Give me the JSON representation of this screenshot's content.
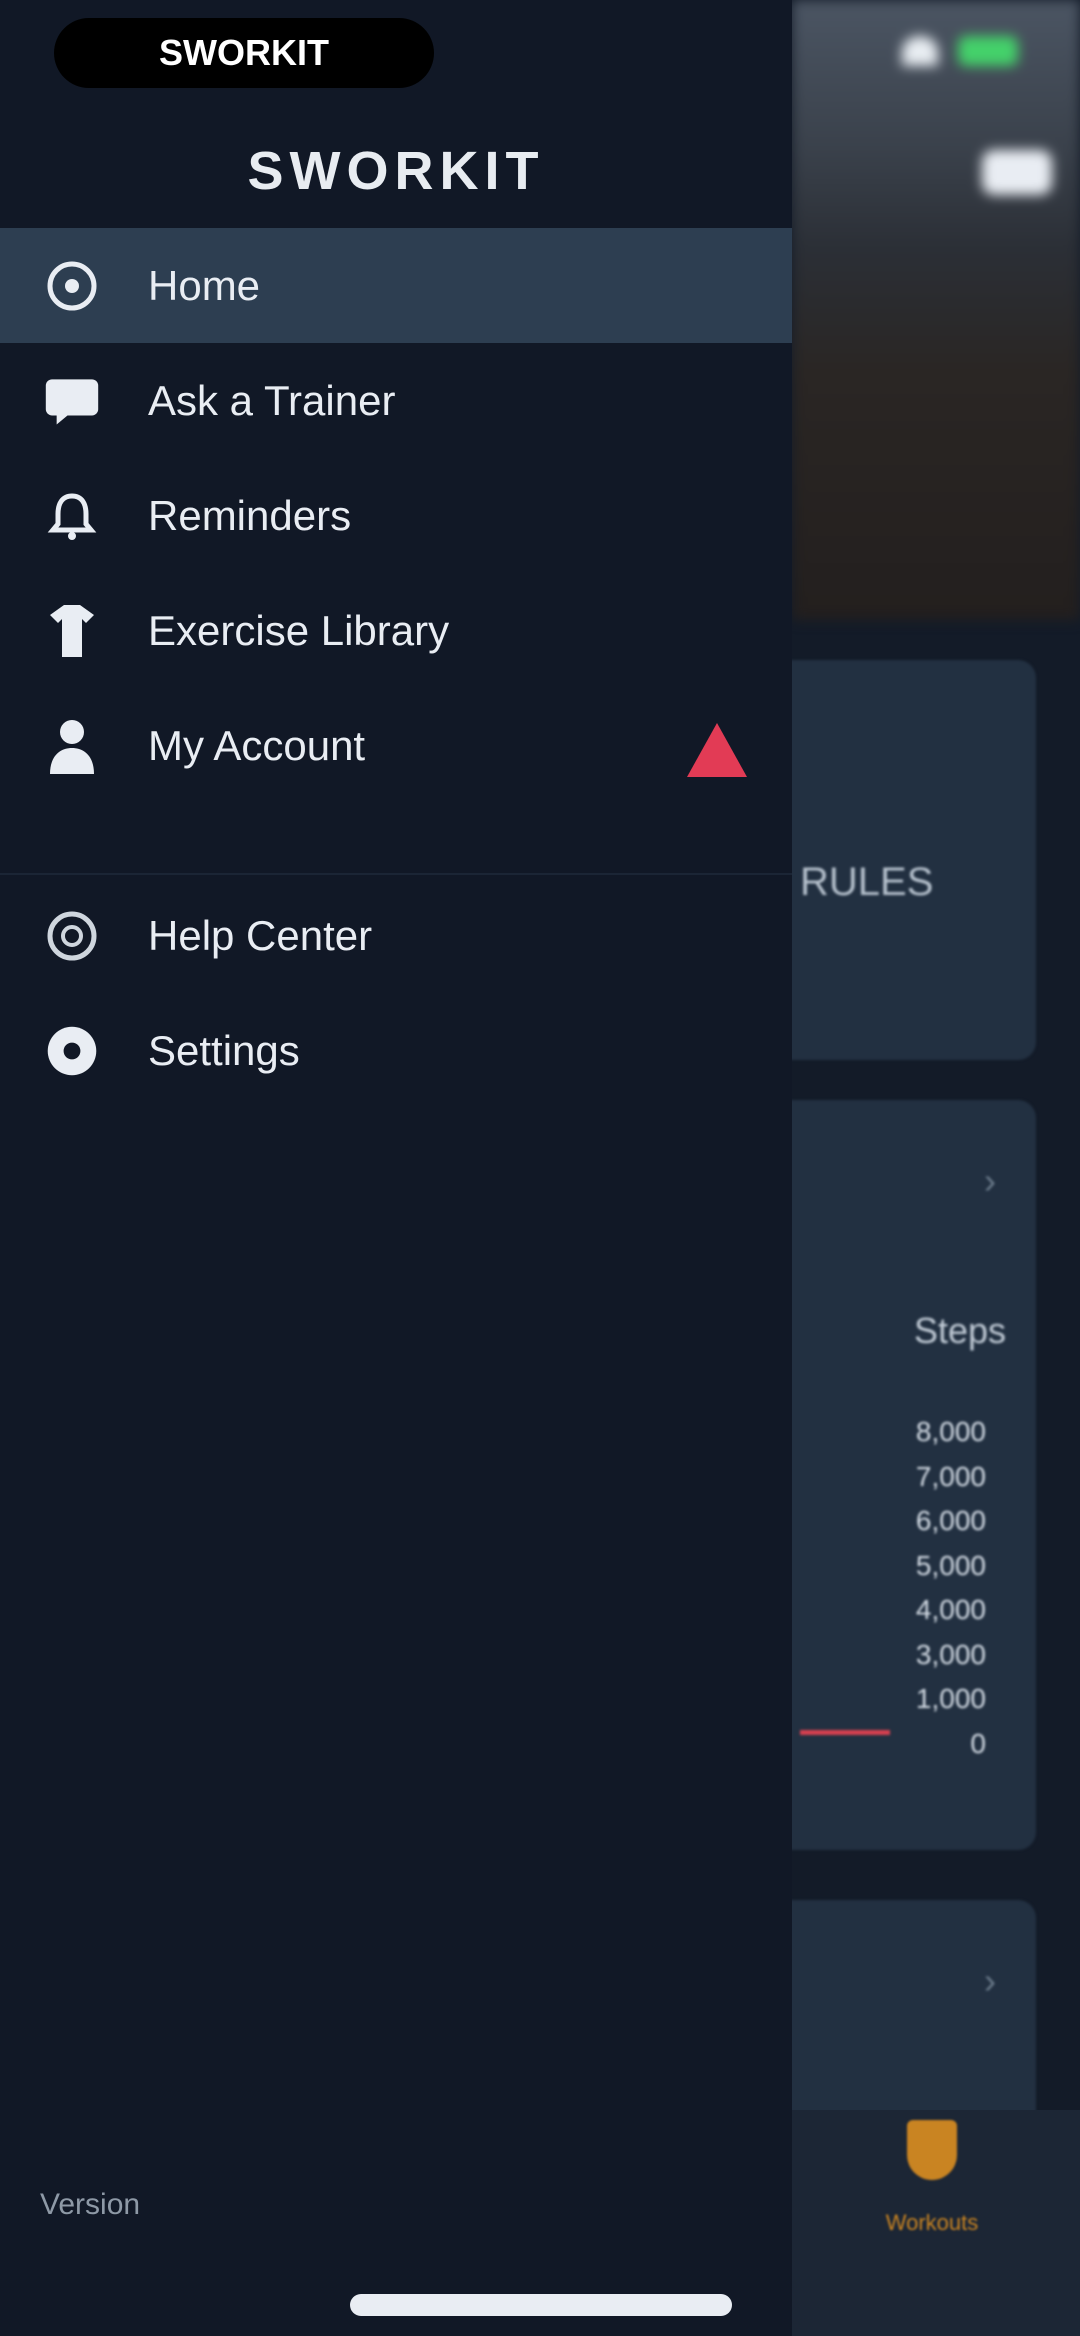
{
  "status_bar": {
    "carrier": "SWORKIT"
  },
  "drawer": {
    "brand": "SWORKIT",
    "items": [
      {
        "label": "Home",
        "icon": "home-circle-icon",
        "active": true
      },
      {
        "label": "Ask a Trainer",
        "icon": "chat-icon",
        "active": false
      },
      {
        "label": "Reminders",
        "icon": "bell-icon",
        "active": false
      },
      {
        "label": "Exercise Library",
        "icon": "shirt-icon",
        "active": false
      },
      {
        "label": "My Account",
        "icon": "user-icon",
        "active": false,
        "alert": true
      }
    ],
    "secondary_items": [
      {
        "label": "Help Center",
        "icon": "help-icon"
      },
      {
        "label": "Settings",
        "icon": "gear-icon"
      }
    ],
    "version": "Version"
  },
  "background": {
    "card1_text": "RULES",
    "card2_header": "Steps",
    "card2_values": [
      "8,000",
      "7,000",
      "6,000",
      "5,000",
      "4,000",
      "3,000",
      "1,000",
      "0"
    ],
    "tab_label": "Workouts"
  },
  "colors": {
    "drawer_bg": "#111826",
    "active_item": "#2d3e51",
    "alert": "#e23b55",
    "accent": "#c98422"
  }
}
